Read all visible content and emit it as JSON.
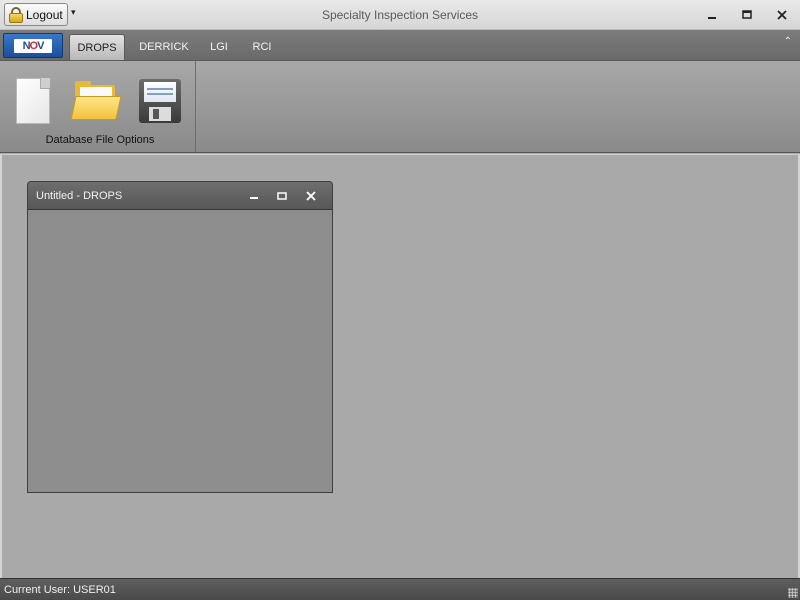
{
  "titlebar": {
    "app_title": "Specialty Inspection Services",
    "logout_label": "Logout",
    "quick_access_glyph": "▾",
    "minimize_glyph": "▭",
    "restore_glyph": "◫",
    "close_glyph": "✕"
  },
  "ribbon": {
    "app_menu_logo": {
      "part1": "N",
      "part2": "O",
      "part3": "V"
    },
    "tabs": [
      {
        "label": "DROPS",
        "active": true
      },
      {
        "label": "DERRICK",
        "active": false
      },
      {
        "label": "LGI",
        "active": false
      },
      {
        "label": "RCI",
        "active": false
      }
    ],
    "collapse_glyph": "⌃",
    "groups": [
      {
        "label": "Database File Options",
        "buttons": [
          {
            "icon": "new-file-icon"
          },
          {
            "icon": "open-folder-icon"
          },
          {
            "icon": "save-disk-icon"
          }
        ]
      }
    ]
  },
  "child_window": {
    "title": "Untitled - DROPS",
    "minimize_glyph": "▬",
    "restore_glyph": "◻",
    "close_glyph": "✕"
  },
  "status_bar": {
    "current_user": "Current User: USER01"
  },
  "colors": {
    "accent_blue": "#1b4f9a",
    "logo_red": "#dd2222",
    "workspace_bg": "#a9a9a9",
    "child_bg": "#8d8d8d"
  }
}
